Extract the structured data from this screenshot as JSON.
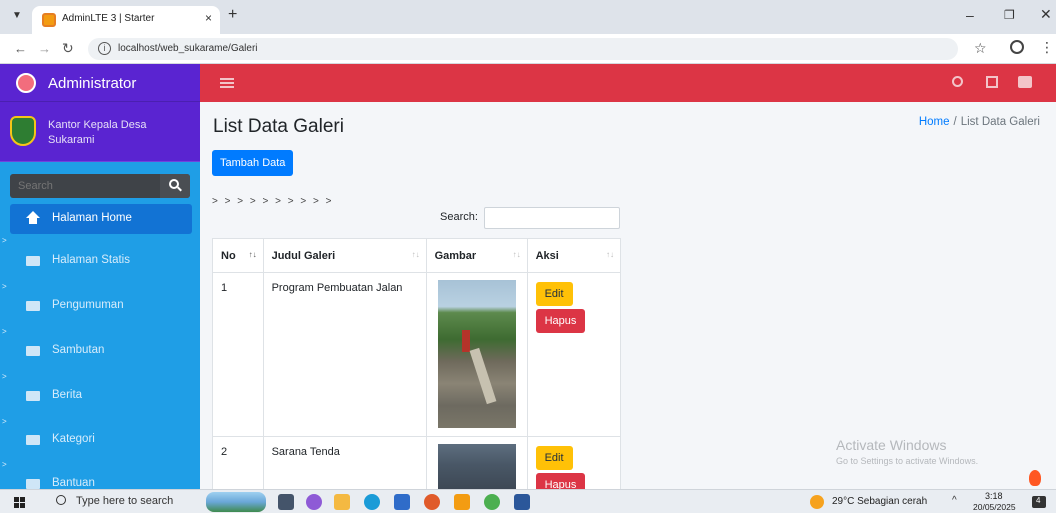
{
  "browser": {
    "tab_title": "AdminLTE 3 | Starter",
    "tab_close": "×",
    "new_tab": "+",
    "url": "localhost/web_sukarame/Galeri"
  },
  "sidebar": {
    "brand": "Administrator",
    "user_name_line1": "Kantor Kepala Desa",
    "user_name_line2": "Sukarami",
    "search_placeholder": "Search",
    "items": [
      {
        "label": "Halaman Home",
        "active": true
      },
      {
        "label": "Halaman Statis",
        "active": false
      },
      {
        "label": "Pengumuman",
        "active": false
      },
      {
        "label": "Sambutan",
        "active": false
      },
      {
        "label": "Berita",
        "active": false
      },
      {
        "label": "Kategori",
        "active": false
      },
      {
        "label": "Bantuan",
        "active": false
      }
    ]
  },
  "content": {
    "title": "List Data Galeri",
    "breadcrumb": {
      "home": "Home",
      "separator": "/",
      "current": "List Data Galeri"
    },
    "add_button": "Tambah Data",
    "pager": "> > > > > > > > > >",
    "search_label": "Search:",
    "columns": [
      "No",
      "Judul Galeri",
      "Gambar",
      "Aksi"
    ],
    "rows": [
      {
        "no": "1",
        "judul": "Program Pembuatan Jalan"
      },
      {
        "no": "2",
        "judul": "Sarana Tenda"
      }
    ],
    "edit_label": "Edit",
    "delete_label": "Hapus"
  },
  "watermark": {
    "title": "Activate Windows",
    "subtitle": "Go to Settings to activate Windows."
  },
  "taskbar": {
    "search_placeholder": "Type here to search",
    "weather": "29°C  Sebagian cerah",
    "time": "3:18",
    "date": "20/05/2025",
    "notification_count": "4"
  }
}
